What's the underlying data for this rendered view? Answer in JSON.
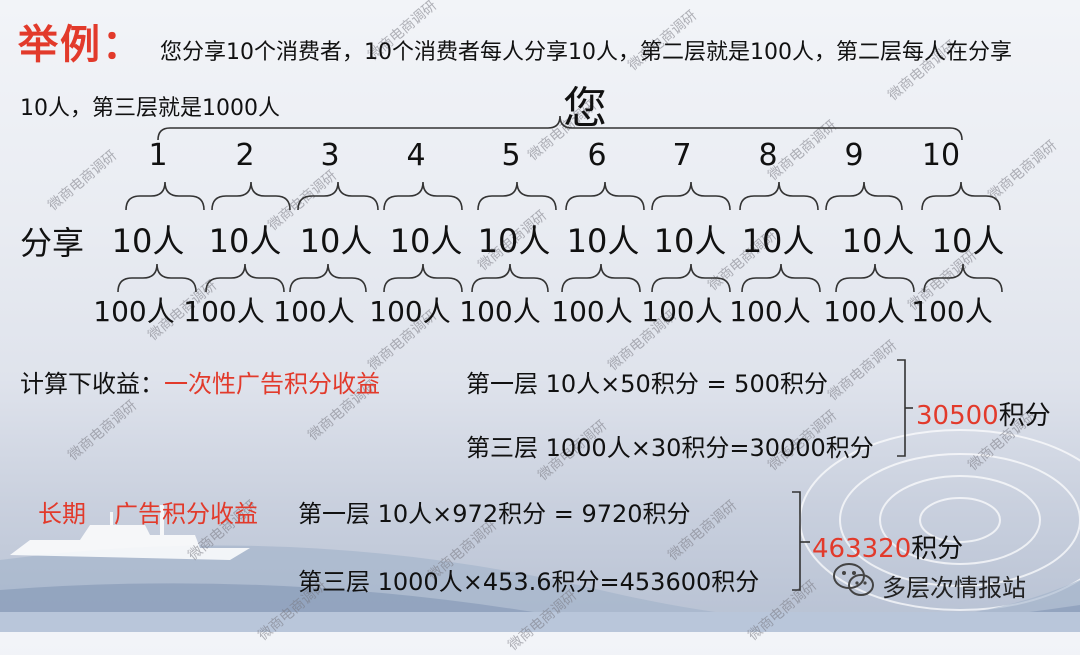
{
  "title": "举例：",
  "intro": {
    "line1": "您分享10个消费者，10个消费者每人分享10人，第二层就是100人，第二层每人在分享",
    "line2": "10人，第三层就是1000人"
  },
  "top_node": "您",
  "level1_numbers": [
    "1",
    "2",
    "3",
    "4",
    "5",
    "6",
    "7",
    "8",
    "9",
    "10"
  ],
  "share_label": "分享",
  "level2_label": "10人",
  "level3_label": "100人",
  "calc": {
    "label": "计算下收益：",
    "one_time": {
      "title": "一次性广告积分收益",
      "row1": "第一层  10人×50积分 = 500积分",
      "row3": "第三层 1000人×30积分=30000积分",
      "total_num": "30500",
      "total_unit": "积分"
    },
    "long_term": {
      "title_a": "长期",
      "title_b": "广告积分收益",
      "row1": "第一层   10人×972积分 = 9720积分",
      "row3": "第三层  1000人×453.6积分=453600积分",
      "total_num": "463320",
      "total_unit": "积分"
    }
  },
  "watermark": "微商电商调研",
  "credit": "多层次情报站",
  "colors": {
    "accent": "#e23a2b",
    "text": "#111111"
  },
  "icons": {
    "credit": "wechat-icon"
  }
}
